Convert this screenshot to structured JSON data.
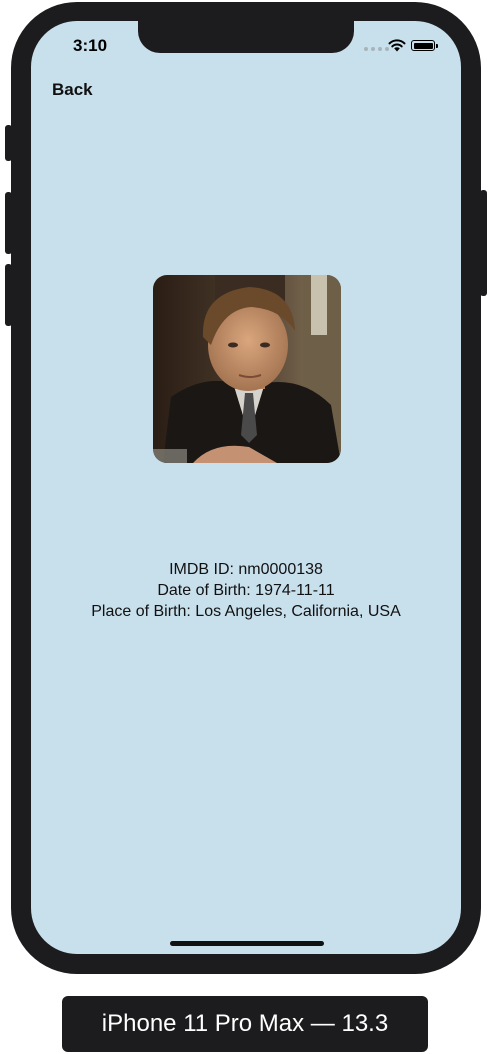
{
  "status_bar": {
    "time": "3:10"
  },
  "nav": {
    "back_label": "Back"
  },
  "profile": {
    "photo_icon": "actor-portrait-photo",
    "imdb_line": "IMDB ID: nm0000138",
    "birth_date_line": "Date of Birth: 1974-11-11",
    "birth_place_line": "Place of Birth: Los Angeles, California, USA"
  },
  "device_caption": "iPhone 11 Pro Max — 13.3",
  "colors": {
    "screen_background": "#c8dfec",
    "device_frame": "#1c1c1e"
  }
}
